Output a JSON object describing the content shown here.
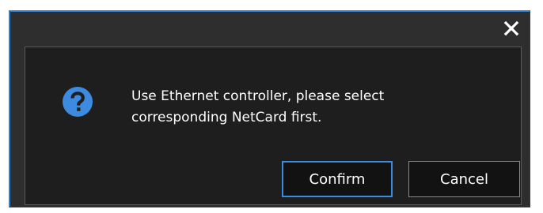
{
  "dialog": {
    "close_icon": "close-icon",
    "status_icon": "question-icon",
    "accent_color": "#3d8be0",
    "message_lines": [
      "Use Ethernet controller, please select",
      "corresponding NetCard first."
    ],
    "confirm_label": "Confirm",
    "cancel_label": "Cancel"
  }
}
